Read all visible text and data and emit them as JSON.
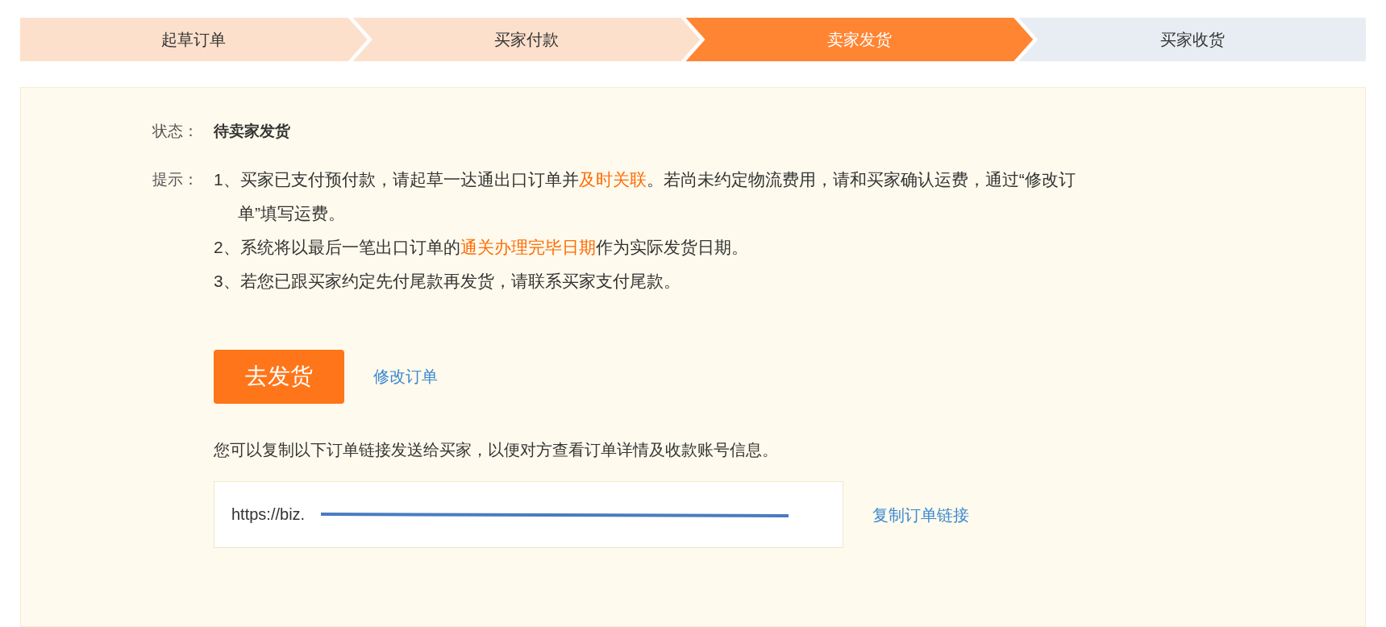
{
  "steps": [
    {
      "label": "起草订单",
      "completed": true,
      "selected": false
    },
    {
      "label": "买家付款",
      "completed": true,
      "selected": false
    },
    {
      "label": "卖家发货",
      "selected": true
    },
    {
      "label": "买家收货",
      "completed": false,
      "selected": false
    }
  ],
  "status": {
    "label": "状态：",
    "value": "待卖家发货"
  },
  "tips": {
    "label": "提示：",
    "items": [
      {
        "number": "1、",
        "segments": [
          {
            "text": "买家已支付预付款，请起草一达通出口订单并",
            "highlight": false
          },
          {
            "text": "及时关联",
            "highlight": true
          },
          {
            "text": "。若尚未约定物流费用，请和买家确认运费，通过“修改订单”填写运费。",
            "highlight": false
          }
        ]
      },
      {
        "number": "2、",
        "segments": [
          {
            "text": "系统将以最后一笔出口订单的",
            "highlight": false
          },
          {
            "text": "通关办理完毕日期",
            "highlight": true
          },
          {
            "text": "作为实际发货日期。",
            "highlight": false
          }
        ]
      },
      {
        "number": "3、",
        "segments": [
          {
            "text": "若您已跟买家约定先付尾款再发货，请联系买家支付尾款。",
            "highlight": false
          }
        ]
      }
    ]
  },
  "ship_button": "去发货",
  "edit_link": "修改订单",
  "share_note": "您可以复制以下订单链接发送给买家，以便对方查看订单详情及收款账号信息。",
  "order_link": {
    "value": "https://biz.",
    "redacted": true
  },
  "copy_link": "复制订单链接"
}
